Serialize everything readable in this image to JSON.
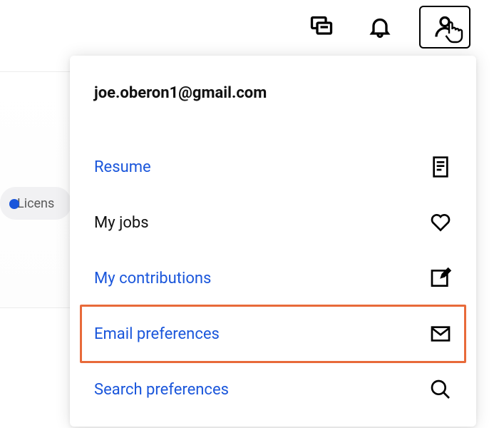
{
  "toolbar": {
    "messages_name": "messages-icon",
    "notifications_name": "bell-icon",
    "profile_name": "person-icon"
  },
  "background": {
    "chip_label": "Licens"
  },
  "dropdown": {
    "user_email": "joe.oberon1@gmail.com",
    "items": [
      {
        "label": "Resume",
        "style": "link",
        "name": "menu-resume",
        "icon": "document-icon"
      },
      {
        "label": "My jobs",
        "style": "plain",
        "name": "menu-my-jobs",
        "icon": "heart-icon"
      },
      {
        "label": "My contributions",
        "style": "link",
        "name": "menu-my-contributions",
        "icon": "edit-icon"
      },
      {
        "label": "Email preferences",
        "style": "link",
        "name": "menu-email-preferences",
        "icon": "mail-icon",
        "highlighted": true
      },
      {
        "label": "Search preferences",
        "style": "link",
        "name": "menu-search-preferences",
        "icon": "search-icon"
      }
    ]
  }
}
